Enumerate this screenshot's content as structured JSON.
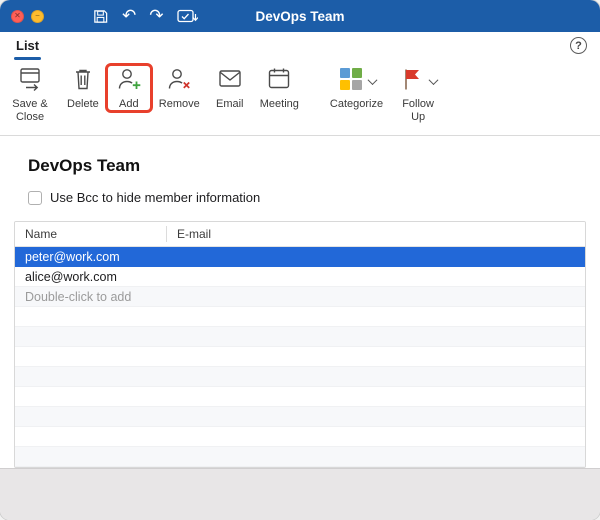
{
  "titlebar": {
    "title": "DevOps Team"
  },
  "tabbar": {
    "active_tab": "List"
  },
  "icons": {
    "close_glyph": "✕",
    "minimize_glyph": "−",
    "undo_glyph": "↶",
    "redo_glyph": "↷",
    "help_glyph": "?"
  },
  "ribbon": {
    "buttons": [
      {
        "label": "Save & Close"
      },
      {
        "label": "Delete"
      },
      {
        "label": "Add",
        "annotated": true
      },
      {
        "label": "Remove"
      },
      {
        "label": "Email"
      },
      {
        "label": "Meeting"
      },
      {
        "label": "Categorize",
        "has_dropdown": true
      },
      {
        "label": "Follow Up",
        "has_dropdown": true
      }
    ]
  },
  "content": {
    "heading": "DevOps Team",
    "bcc_label": "Use Bcc to hide member information",
    "bcc_checked": false
  },
  "member_table": {
    "columns": [
      "Name",
      "E-mail"
    ],
    "rows": [
      {
        "name": "peter@work.com",
        "email": "",
        "state": "selected"
      },
      {
        "name": "alice@work.com",
        "email": "",
        "state": "normal"
      },
      {
        "name": "Double-click to add",
        "email": "",
        "state": "placeholder"
      }
    ],
    "empty_rows": 8
  },
  "colors": {
    "titlebar_blue": "#1c5da8",
    "accent_blue": "#1c5da8",
    "selection_blue": "#2268d8",
    "annotation_red": "#e8402c",
    "category_blue": "#5b9bd5",
    "category_green": "#70ad47",
    "category_yellow": "#ffc000",
    "category_gray": "#a6a6a6",
    "flag_red": "#d93a2b",
    "add_plus_green": "#3fa33f",
    "remove_x_red": "#d0342c"
  }
}
